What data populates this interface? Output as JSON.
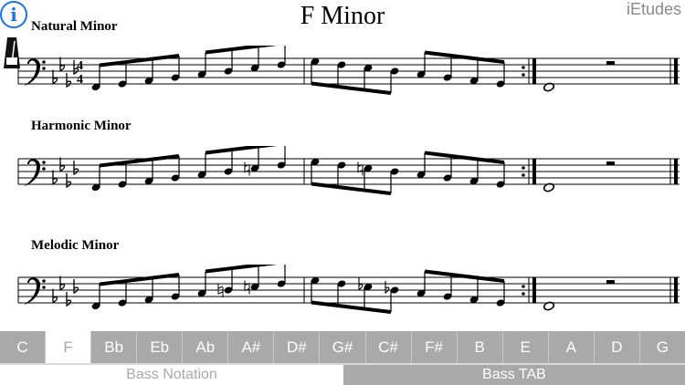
{
  "header": {
    "info_symbol": "i",
    "title": "F Minor",
    "brand": "iEtudes"
  },
  "sections": [
    {
      "label": "Natural Minor"
    },
    {
      "label": "Harmonic Minor"
    },
    {
      "label": "Melodic Minor"
    }
  ],
  "keys": [
    "C",
    "F",
    "Bb",
    "Eb",
    "Ab",
    "A#",
    "D#",
    "G#",
    "C#",
    "F#",
    "B",
    "E",
    "A",
    "D",
    "G"
  ],
  "selected_key": "F",
  "modes": {
    "bass_notation": "Bass Notation",
    "bass_tab": "Bass TAB",
    "active": "Bass TAB"
  },
  "colors": {
    "info_blue": "#1a73e8",
    "tab_gray": "#a9a9a9",
    "tab_text": "#ffffff",
    "title": "#000000"
  },
  "icons": {
    "info": "info-icon",
    "metronome": "metronome-icon"
  }
}
